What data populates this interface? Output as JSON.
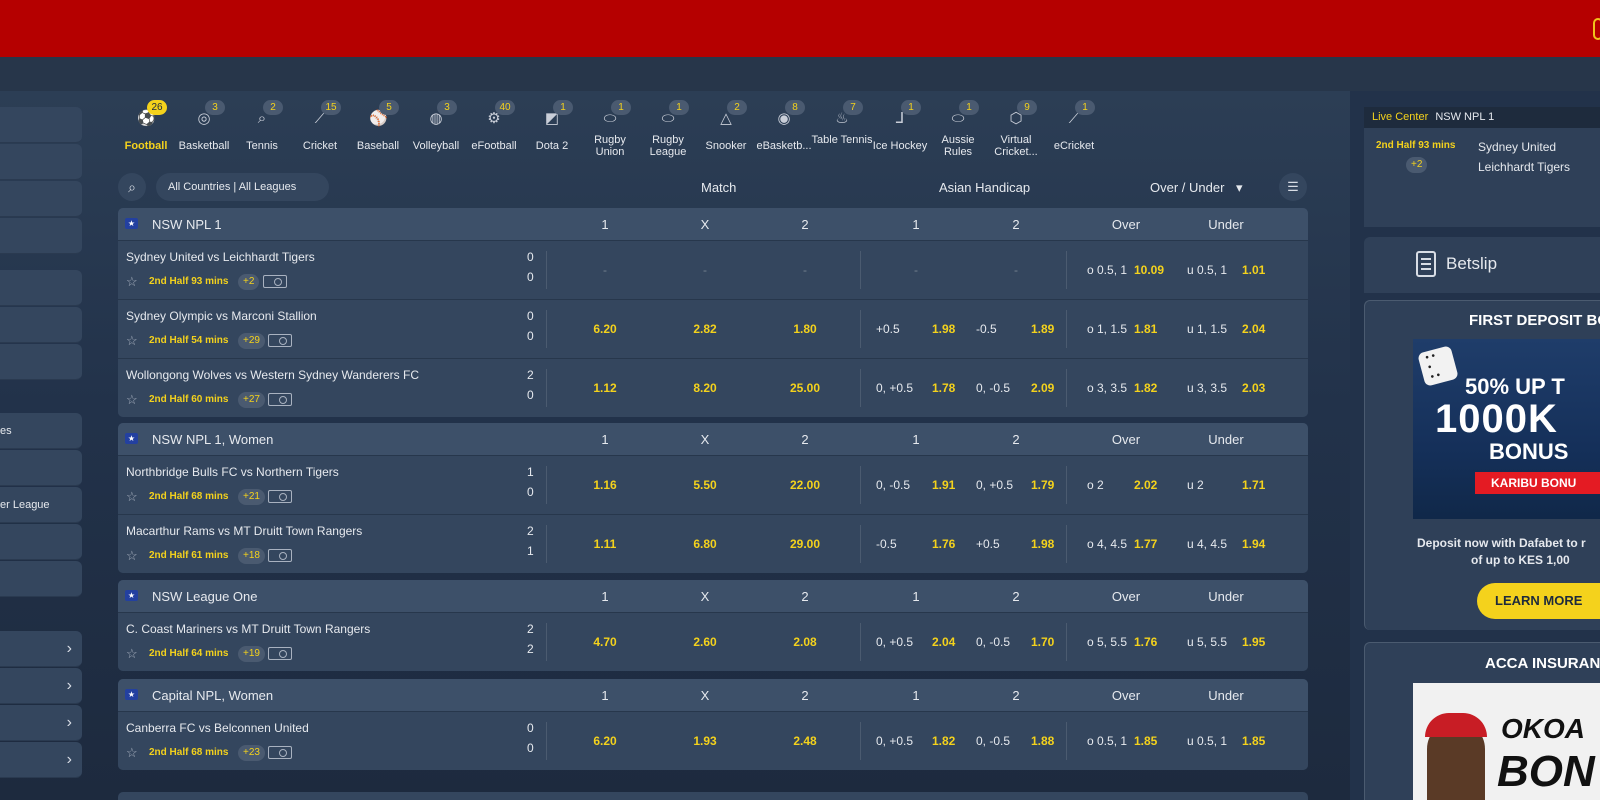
{
  "sports": [
    {
      "label": "Football",
      "count": "26",
      "icon": "⚽",
      "active": true
    },
    {
      "label": "Basketball",
      "count": "3",
      "icon": "◎"
    },
    {
      "label": "Tennis",
      "count": "2",
      "icon": "⌕"
    },
    {
      "label": "Cricket",
      "count": "15",
      "icon": "⟋"
    },
    {
      "label": "Baseball",
      "count": "5",
      "icon": "⚾"
    },
    {
      "label": "Volleyball",
      "count": "3",
      "icon": "◍"
    },
    {
      "label": "eFootball",
      "count": "40",
      "icon": "⚙"
    },
    {
      "label": "Dota 2",
      "count": "1",
      "icon": "◩"
    },
    {
      "label": "Rugby Union",
      "count": "1",
      "icon": "⬭"
    },
    {
      "label": "Rugby League",
      "count": "1",
      "icon": "⬭"
    },
    {
      "label": "Snooker",
      "count": "2",
      "icon": "△"
    },
    {
      "label": "eBasketb...",
      "count": "8",
      "icon": "◉"
    },
    {
      "label": "Table Tennis",
      "count": "7",
      "icon": "♨"
    },
    {
      "label": "Ice Hockey",
      "count": "1",
      "icon": "⅃"
    },
    {
      "label": "Aussie Rules",
      "count": "1",
      "icon": "⬭"
    },
    {
      "label": "Virtual Cricket...",
      "count": "9",
      "icon": "⬡"
    },
    {
      "label": "eCricket",
      "count": "1",
      "icon": "⟋"
    }
  ],
  "filters": {
    "country_label": "All Countries | All Leagues",
    "match_label": "Match",
    "handicap_label": "Asian Handicap",
    "ou_label": "Over / Under",
    "ou_caret": "▾"
  },
  "columns": {
    "c1": "1",
    "cx": "X",
    "c2": "2",
    "h1": "1",
    "h2": "2",
    "over": "Over",
    "under": "Under"
  },
  "sidebar": {
    "item_a": "es",
    "item_b": "er League",
    "arrow": "›"
  },
  "leagues": [
    {
      "name": "NSW NPL 1",
      "matches": [
        {
          "teams": "Sydney United  vs Leichhardt Tigers",
          "s1": "0",
          "s2": "0",
          "time": "2nd Half 93 mins",
          "more": "+2",
          "o1": "-",
          "ox": "-",
          "o2": "-",
          "h1": "-",
          "h1v": "",
          "h2": "-",
          "h2v": "",
          "ov": "o 0.5, 1",
          "ovv": "10.09",
          "un": "u 0.5, 1",
          "unv": "1.01"
        },
        {
          "teams": "Sydney Olympic  vs Marconi Stallion",
          "s1": "0",
          "s2": "0",
          "time": "2nd Half 54 mins",
          "more": "+29",
          "o1": "6.20",
          "ox": "2.82",
          "o2": "1.80",
          "h1": "+0.5",
          "h1v": "1.98",
          "h2": "-0.5",
          "h2v": "1.89",
          "ov": "o 1, 1.5",
          "ovv": "1.81",
          "un": "u 1, 1.5",
          "unv": "2.04"
        },
        {
          "teams": "Wollongong Wolves  vs Western Sydney Wanderers FC",
          "s1": "2",
          "s2": "0",
          "time": "2nd Half 60 mins",
          "more": "+27",
          "o1": "1.12",
          "ox": "8.20",
          "o2": "25.00",
          "h1": "0, +0.5",
          "h1v": "1.78",
          "h2": "0, -0.5",
          "h2v": "2.09",
          "ov": "o 3, 3.5",
          "ovv": "1.82",
          "un": "u 3, 3.5",
          "unv": "2.03"
        }
      ]
    },
    {
      "name": "NSW NPL 1, Women",
      "matches": [
        {
          "teams": "Northbridge Bulls FC  vs Northern Tigers",
          "s1": "1",
          "s2": "0",
          "time": "2nd Half 68 mins",
          "more": "+21",
          "o1": "1.16",
          "ox": "5.50",
          "o2": "22.00",
          "h1": "0, -0.5",
          "h1v": "1.91",
          "h2": "0, +0.5",
          "h2v": "1.79",
          "ov": "o 2",
          "ovv": "2.02",
          "un": "u 2",
          "unv": "1.71"
        },
        {
          "teams": "Macarthur Rams  vs MT Druitt Town Rangers",
          "s1": "2",
          "s2": "1",
          "time": "2nd Half 61 mins",
          "more": "+18",
          "o1": "1.11",
          "ox": "6.80",
          "o2": "29.00",
          "h1": "-0.5",
          "h1v": "1.76",
          "h2": "+0.5",
          "h2v": "1.98",
          "ov": "o 4, 4.5",
          "ovv": "1.77",
          "un": "u 4, 4.5",
          "unv": "1.94"
        }
      ]
    },
    {
      "name": "NSW League One",
      "matches": [
        {
          "teams": "C. Coast Mariners  vs MT Druitt Town Rangers",
          "s1": "2",
          "s2": "2",
          "time": "2nd Half 64 mins",
          "more": "+19",
          "o1": "4.70",
          "ox": "2.60",
          "o2": "2.08",
          "h1": "0, +0.5",
          "h1v": "2.04",
          "h2": "0, -0.5",
          "h2v": "1.70",
          "ov": "o 5, 5.5",
          "ovv": "1.76",
          "un": "u 5, 5.5",
          "unv": "1.95"
        }
      ]
    },
    {
      "name": "Capital NPL, Women",
      "matches": [
        {
          "teams": "Canberra FC  vs Belconnen United",
          "s1": "0",
          "s2": "0",
          "time": "2nd Half 68 mins",
          "more": "+23",
          "o1": "6.20",
          "ox": "1.93",
          "o2": "2.48",
          "h1": "0, +0.5",
          "h1v": "1.82",
          "h2": "0, -0.5",
          "h2v": "1.88",
          "ov": "o 0.5, 1",
          "ovv": "1.85",
          "un": "u 0.5, 1",
          "unv": "1.85"
        }
      ]
    }
  ],
  "live": {
    "title": "Live Center",
    "league": "NSW NPL 1",
    "time": "2nd Half 93 mins",
    "more": "+2",
    "team1": "Sydney United",
    "team2": "Leichhardt Tigers"
  },
  "betslip": {
    "label": "Betslip"
  },
  "promo1": {
    "title": "FIRST DEPOSIT BO",
    "img_l1": "50% UP T",
    "img_l2": "1000K",
    "img_l3": "BONUS",
    "img_l4": "KARIBU BONU",
    "text1": "Deposit now with Dafabet to r",
    "text2": "of up to KES 1,00",
    "button": "LEARN MORE"
  },
  "promo2": {
    "title": "ACCA INSURAN",
    "img_l1": "OKOA",
    "img_l2": "BON"
  },
  "colors": {
    "topbar": "#b50000",
    "accent": "#f4d21c",
    "panel": "#34465e"
  }
}
